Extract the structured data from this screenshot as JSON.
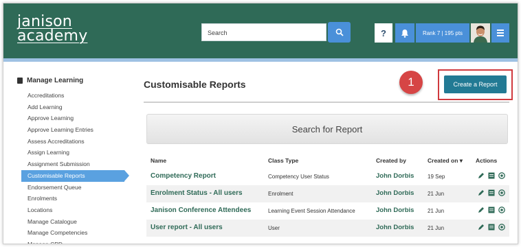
{
  "header": {
    "logo_line1": "janison",
    "logo_line2": "academy",
    "search_placeholder": "Search",
    "help_label": "?",
    "rank_label": "Rank 7 | 195 pts",
    "colors": {
      "header_bg": "#2f6a57",
      "accent_blue": "#4a90d9"
    }
  },
  "sidebar": {
    "heading": "Manage Learning",
    "items": [
      "Accreditations",
      "Add Learning",
      "Approve Learning",
      "Approve Learning Entries",
      "Assess Accreditations",
      "Assign Learning",
      "Assignment Submission",
      "Customisable Reports",
      "Endorsement Queue",
      "Enrolments",
      "Locations",
      "Manage Catalogue",
      "Manage Competencies",
      "Manage CPD"
    ],
    "active_index": 7
  },
  "main": {
    "title": "Customisable Reports",
    "callout_number": "1",
    "create_button": "Create a Report",
    "search_report": "Search for Report",
    "columns": {
      "name": "Name",
      "class_type": "Class Type",
      "created_by": "Created by",
      "created_on": "Created on ▾",
      "actions": "Actions"
    },
    "rows": [
      {
        "name": "Competency Report",
        "class_type": "Competency User Status",
        "created_by": "John Dorbis",
        "created_on": "19 Sep"
      },
      {
        "name": "Enrolment Status - All users",
        "class_type": "Enrolment",
        "created_by": "John Dorbis",
        "created_on": "21 Jun"
      },
      {
        "name": "Janison Conference Attendees",
        "class_type": "Learning Event Session Attendance",
        "created_by": "John Dorbis",
        "created_on": "21 Jun"
      },
      {
        "name": "User report - All users",
        "class_type": "User",
        "created_by": "John Dorbis",
        "created_on": "21 Jun"
      }
    ],
    "action_icons": [
      "pencil-icon",
      "table-icon",
      "download-icon"
    ]
  }
}
